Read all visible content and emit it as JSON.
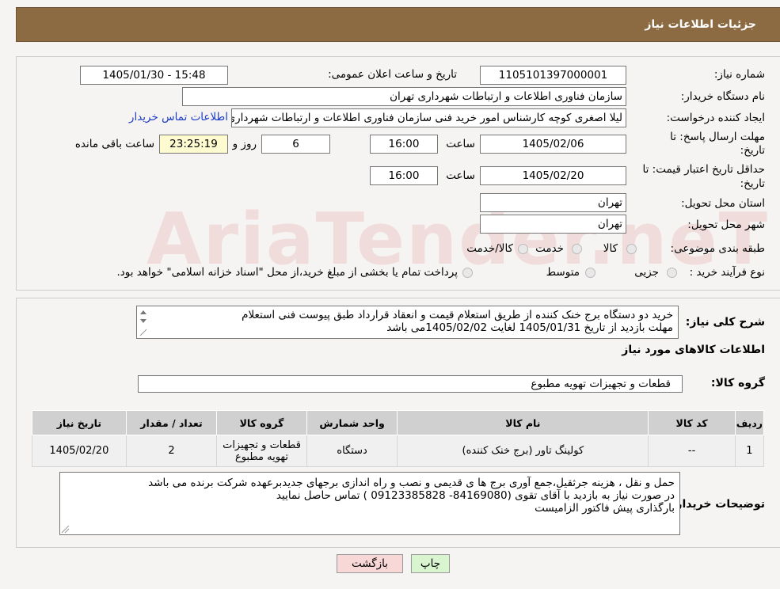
{
  "header": {
    "title": "جزئیات اطلاعات نیاز"
  },
  "fields": {
    "need_number_label": "شماره نیاز:",
    "need_number": "1105101397000001",
    "announce_label": "تاریخ و ساعت اعلان عمومی:",
    "announce_value": "1405/01/30 - 15:48",
    "buyer_org_label": "نام دستگاه خریدار:",
    "buyer_org": "سازمان فناوری اطلاعات و ارتباطات شهرداری تهران",
    "requester_label": "ایجاد کننده درخواست:",
    "requester": "لیلا اصغری کوچه کارشناس امور خرید فنی سازمان فناوری اطلاعات و ارتباطات شهرداری تهران",
    "contact_link": "اطلاعات تماس خریدار",
    "deadline_label_1": "مهلت ارسال پاسخ: تا",
    "deadline_label_2": "تاریخ:",
    "deadline_date": "1405/02/06",
    "time_label": "ساعت",
    "deadline_time": "16:00",
    "days_value": "6",
    "days_label": "روز و",
    "remaining_time": "23:25:19",
    "remaining_label": "ساعت باقی مانده",
    "validity_label_1": "حداقل تاریخ اعتبار قیمت: تا",
    "validity_label_2": "تاریخ:",
    "validity_date": "1405/02/20",
    "validity_time": "16:00",
    "province_label": "استان محل تحویل:",
    "province": "تهران",
    "city_label": "شهر محل تحویل:",
    "city": "تهران",
    "category_label": "طبقه بندی موضوعی:",
    "category_options": [
      "کالا",
      "خدمت",
      "کالا/خدمت"
    ],
    "process_label": "نوع فرآیند خرید :",
    "process_options": [
      "جزیی",
      "متوسط"
    ],
    "process_note": "پرداخت تمام یا بخشی از مبلغ خرید،از محل \"اسناد خزانه اسلامی\" خواهد بود."
  },
  "description": {
    "label": "شرح کلی نیاز:",
    "line1": "خرید دو دستگاه برج خنک کننده از طریق استعلام قیمت و انعقاد قرارداد طبق پیوست فنی استعلام",
    "line2": "مهلت بازدید از تاریخ 1405/01/31 لغایت 1405/02/02می باشد"
  },
  "goods": {
    "section_title": "اطلاعات کالاهای مورد نیاز",
    "group_label": "گروه کالا:",
    "group_value": "قطعات و تجهیزات تهویه مطبوع"
  },
  "table": {
    "headers": [
      "ردیف",
      "کد کالا",
      "نام کالا",
      "واحد شمارش",
      "گروه کالا",
      "تعداد / مقدار",
      "تاریخ نیاز"
    ],
    "rows": [
      [
        "1",
        "--",
        "کولینگ تاور (برج خنک کننده)",
        "دستگاه",
        "قطعات و تجهیزات تهویه مطبوع",
        "2",
        "1405/02/20"
      ]
    ]
  },
  "buyer_notes": {
    "label": "توضیحات خریدار:",
    "line1": "حمل و نقل ، هزینه جرثقیل،جمع آوری برج ها ی قدیمی و نصب و راه اندازی برجهای جدیدبرعهده شرکت برنده می باشد",
    "line2": "در صورت نیاز به بازدید با آقای تقوی (84169080- 09123385828 ) تماس حاصل نمایید",
    "line3": "بارگذاری پیش فاکتور الزامیست"
  },
  "buttons": {
    "print": "چاپ",
    "back": "بازگشت"
  },
  "colors": {
    "header_bg": "#8c6a42",
    "back_btn": "#f8d7d7",
    "print_btn": "#d9f5d0",
    "link": "#1a3cc8"
  }
}
